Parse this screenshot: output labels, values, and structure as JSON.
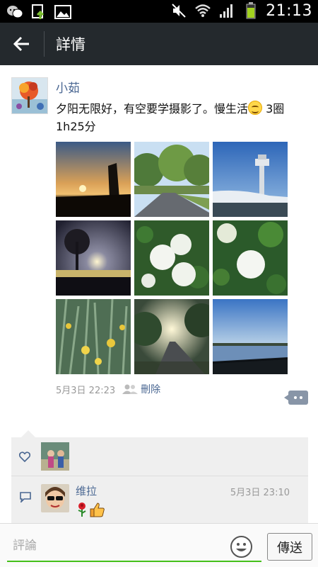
{
  "status_bar": {
    "time": "21:13",
    "icons": [
      "wechat-notification-icon",
      "upload-icon",
      "image-icon",
      "mute-icon",
      "wifi-icon",
      "signal-icon",
      "battery-icon"
    ]
  },
  "header": {
    "title": "詳情",
    "back_icon": "arrow-left-icon"
  },
  "post": {
    "author": "小茹",
    "text_before": "夕阳无限好，有空要学摄影了。慢生活",
    "text_after": " 3圈1h25分",
    "timestamp": "5月3日 22:23",
    "delete_label": "刪除",
    "photos": [
      {
        "scene": "sunset-silhouette"
      },
      {
        "scene": "tree-lined-road"
      },
      {
        "scene": "observation-tower"
      },
      {
        "scene": "sunset-over-water"
      },
      {
        "scene": "white-hydrangea"
      },
      {
        "scene": "white-hydrangea-close"
      },
      {
        "scene": "yellow-iris"
      },
      {
        "scene": "sunlit-path"
      },
      {
        "scene": "lake-with-fence"
      }
    ]
  },
  "likes": {
    "icon": "heart-outline-icon"
  },
  "comments": {
    "icon": "speech-bubble-icon",
    "items": [
      {
        "name": "维拉",
        "time": "5月3日 23:10",
        "emojis": [
          "rose-icon",
          "thumbs-up-icon"
        ]
      }
    ]
  },
  "composer": {
    "placeholder": "評論",
    "send_label": "傳送"
  },
  "colors": {
    "link": "#4a6792",
    "header_bg": "#24292d",
    "accent": "#45c01a"
  }
}
